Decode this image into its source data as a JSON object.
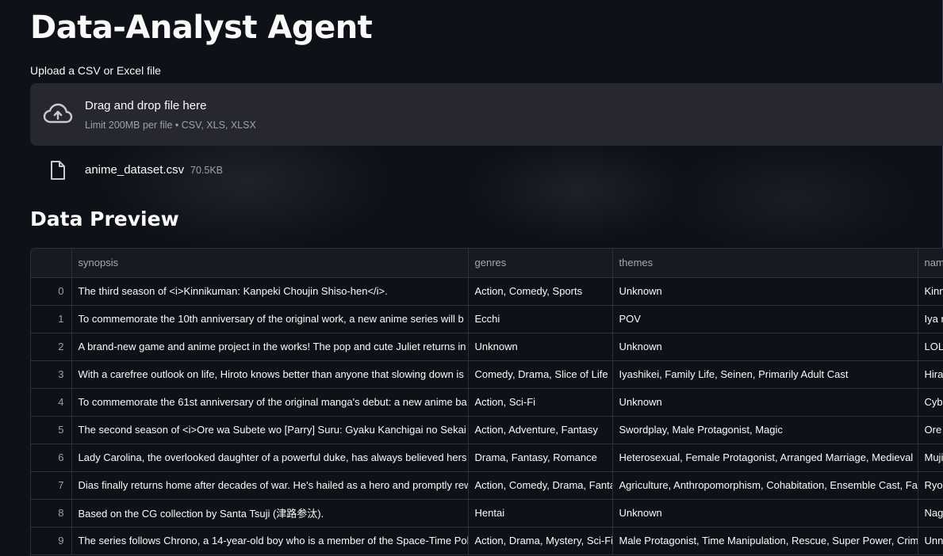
{
  "header": {
    "title": "Data-Analyst Agent"
  },
  "uploader": {
    "label": "Upload a CSV or Excel file",
    "drop_text": "Drag and drop file here",
    "limit_text": "Limit 200MB per file • CSV, XLS, XLSX",
    "icon": "cloud-upload-icon"
  },
  "file": {
    "name": "anime_dataset.csv",
    "size": "70.5KB",
    "icon": "file-icon"
  },
  "preview": {
    "title": "Data Preview",
    "columns": [
      "",
      "synopsis",
      "genres",
      "themes",
      "nam"
    ],
    "rows": [
      [
        "0",
        "The third season of <i>Kinnikuman: Kanpeki Choujin Shiso-hen</i>.",
        "Action, Comedy, Sports",
        "Unknown",
        "Kinn"
      ],
      [
        "1",
        "To commemorate the 10th anniversary of the original work, a new anime series will b",
        "Ecchi",
        "POV",
        "Iya n"
      ],
      [
        "2",
        "A brand-new game and anime project in the works! The pop and cute Juliet returns in",
        "Unknown",
        "Unknown",
        "LOL"
      ],
      [
        "3",
        "With a carefree outlook on life, Hiroto knows better than anyone that slowing down is",
        "Comedy, Drama, Slice of Life",
        "Iyashikei, Family Life, Seinen, Primarily Adult Cast",
        "Hira"
      ],
      [
        "4",
        "To commemorate the 61st anniversary of the original manga's debut: a new anime ba",
        "Action, Sci-Fi",
        "Unknown",
        "Cybe"
      ],
      [
        "5",
        "The second season of <i>Ore wa Subete wo [Parry] Suru: Gyaku Kanchigai no Sekai Sa",
        "Action, Adventure, Fantasy",
        "Swordplay, Male Protagonist, Magic",
        "Ore"
      ],
      [
        "6",
        "Lady Carolina, the overlooked daughter of a powerful duke, has always believed hers",
        "Drama, Fantasy, Romance",
        "Heterosexual, Female Protagonist, Arranged Marriage, Medieval",
        "Muji"
      ],
      [
        "7",
        "Dias finally returns home after decades of war. He's hailed as a hero and promptly rew",
        "Action, Comedy, Drama, Fanta",
        "Agriculture, Anthropomorphism, Cohabitation, Ensemble Cast, Fa",
        "Ryou"
      ],
      [
        "8",
        "Based on the CG collection by Santa Tsuji (津路参汰).",
        "Hentai",
        "Unknown",
        "Nag"
      ],
      [
        "9",
        "The series follows Chrono, a 14-year-old boy who is a member of the Space-Time Poli",
        "Action, Drama, Mystery, Sci-Fi",
        "Male Protagonist, Time Manipulation, Rescue, Super Power, Crim",
        "Unn"
      ]
    ]
  }
}
